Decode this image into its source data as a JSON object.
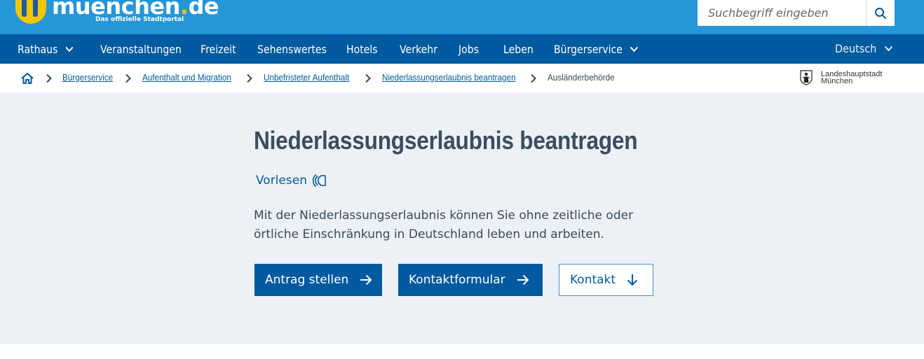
{
  "header": {
    "logo_word_main": "muenchen",
    "logo_word_dot": ".",
    "logo_word_tld": "de",
    "logo_tagline": "Das offizielle Stadtportal",
    "search_placeholder": "Suchbegriff eingeben",
    "search_icon": "search-icon"
  },
  "nav": {
    "items": [
      {
        "label": "Rathaus",
        "has_dropdown": true
      },
      {
        "label": "Veranstaltungen",
        "has_dropdown": false
      },
      {
        "label": "Freizeit",
        "has_dropdown": false
      },
      {
        "label": "Sehenswertes",
        "has_dropdown": false
      },
      {
        "label": "Hotels",
        "has_dropdown": false
      },
      {
        "label": "Verkehr",
        "has_dropdown": false
      },
      {
        "label": "Jobs",
        "has_dropdown": false
      },
      {
        "label": "Leben",
        "has_dropdown": false
      },
      {
        "label": "Bürgerservice",
        "has_dropdown": true
      }
    ],
    "language": "Deutsch"
  },
  "breadcrumb": {
    "home_icon": "home-icon",
    "items": [
      {
        "label": "Bürgerservice"
      },
      {
        "label": "Aufenthalt und Migration"
      },
      {
        "label": "Unbefristeter Aufenthalt"
      },
      {
        "label": "Niederlassungserlaubnis beantragen"
      },
      {
        "label": "Ausländerbehörde"
      }
    ],
    "city_line1": "Landeshauptstadt",
    "city_line2": "München"
  },
  "hero": {
    "title": "Niederlassungserlaubnis beantragen",
    "read_aloud": "Vorlesen",
    "intro": "Mit der Niederlassungserlaubnis können Sie ohne zeitliche oder örtliche Einschränkung in Deutschland leben und arbeiten.",
    "buttons": [
      {
        "label": "Antrag stellen",
        "icon": "arrow-right-icon"
      },
      {
        "label": "Kontaktformular",
        "icon": "arrow-right-icon"
      },
      {
        "label": "Kontakt",
        "icon": "arrow-down-icon"
      }
    ]
  },
  "colors": {
    "header_blue": "#2596d8",
    "nav_blue": "#005a9f",
    "brand_yellow": "#f6c400",
    "hero_bg": "#edf1f5",
    "title_text": "#3a4d61"
  }
}
